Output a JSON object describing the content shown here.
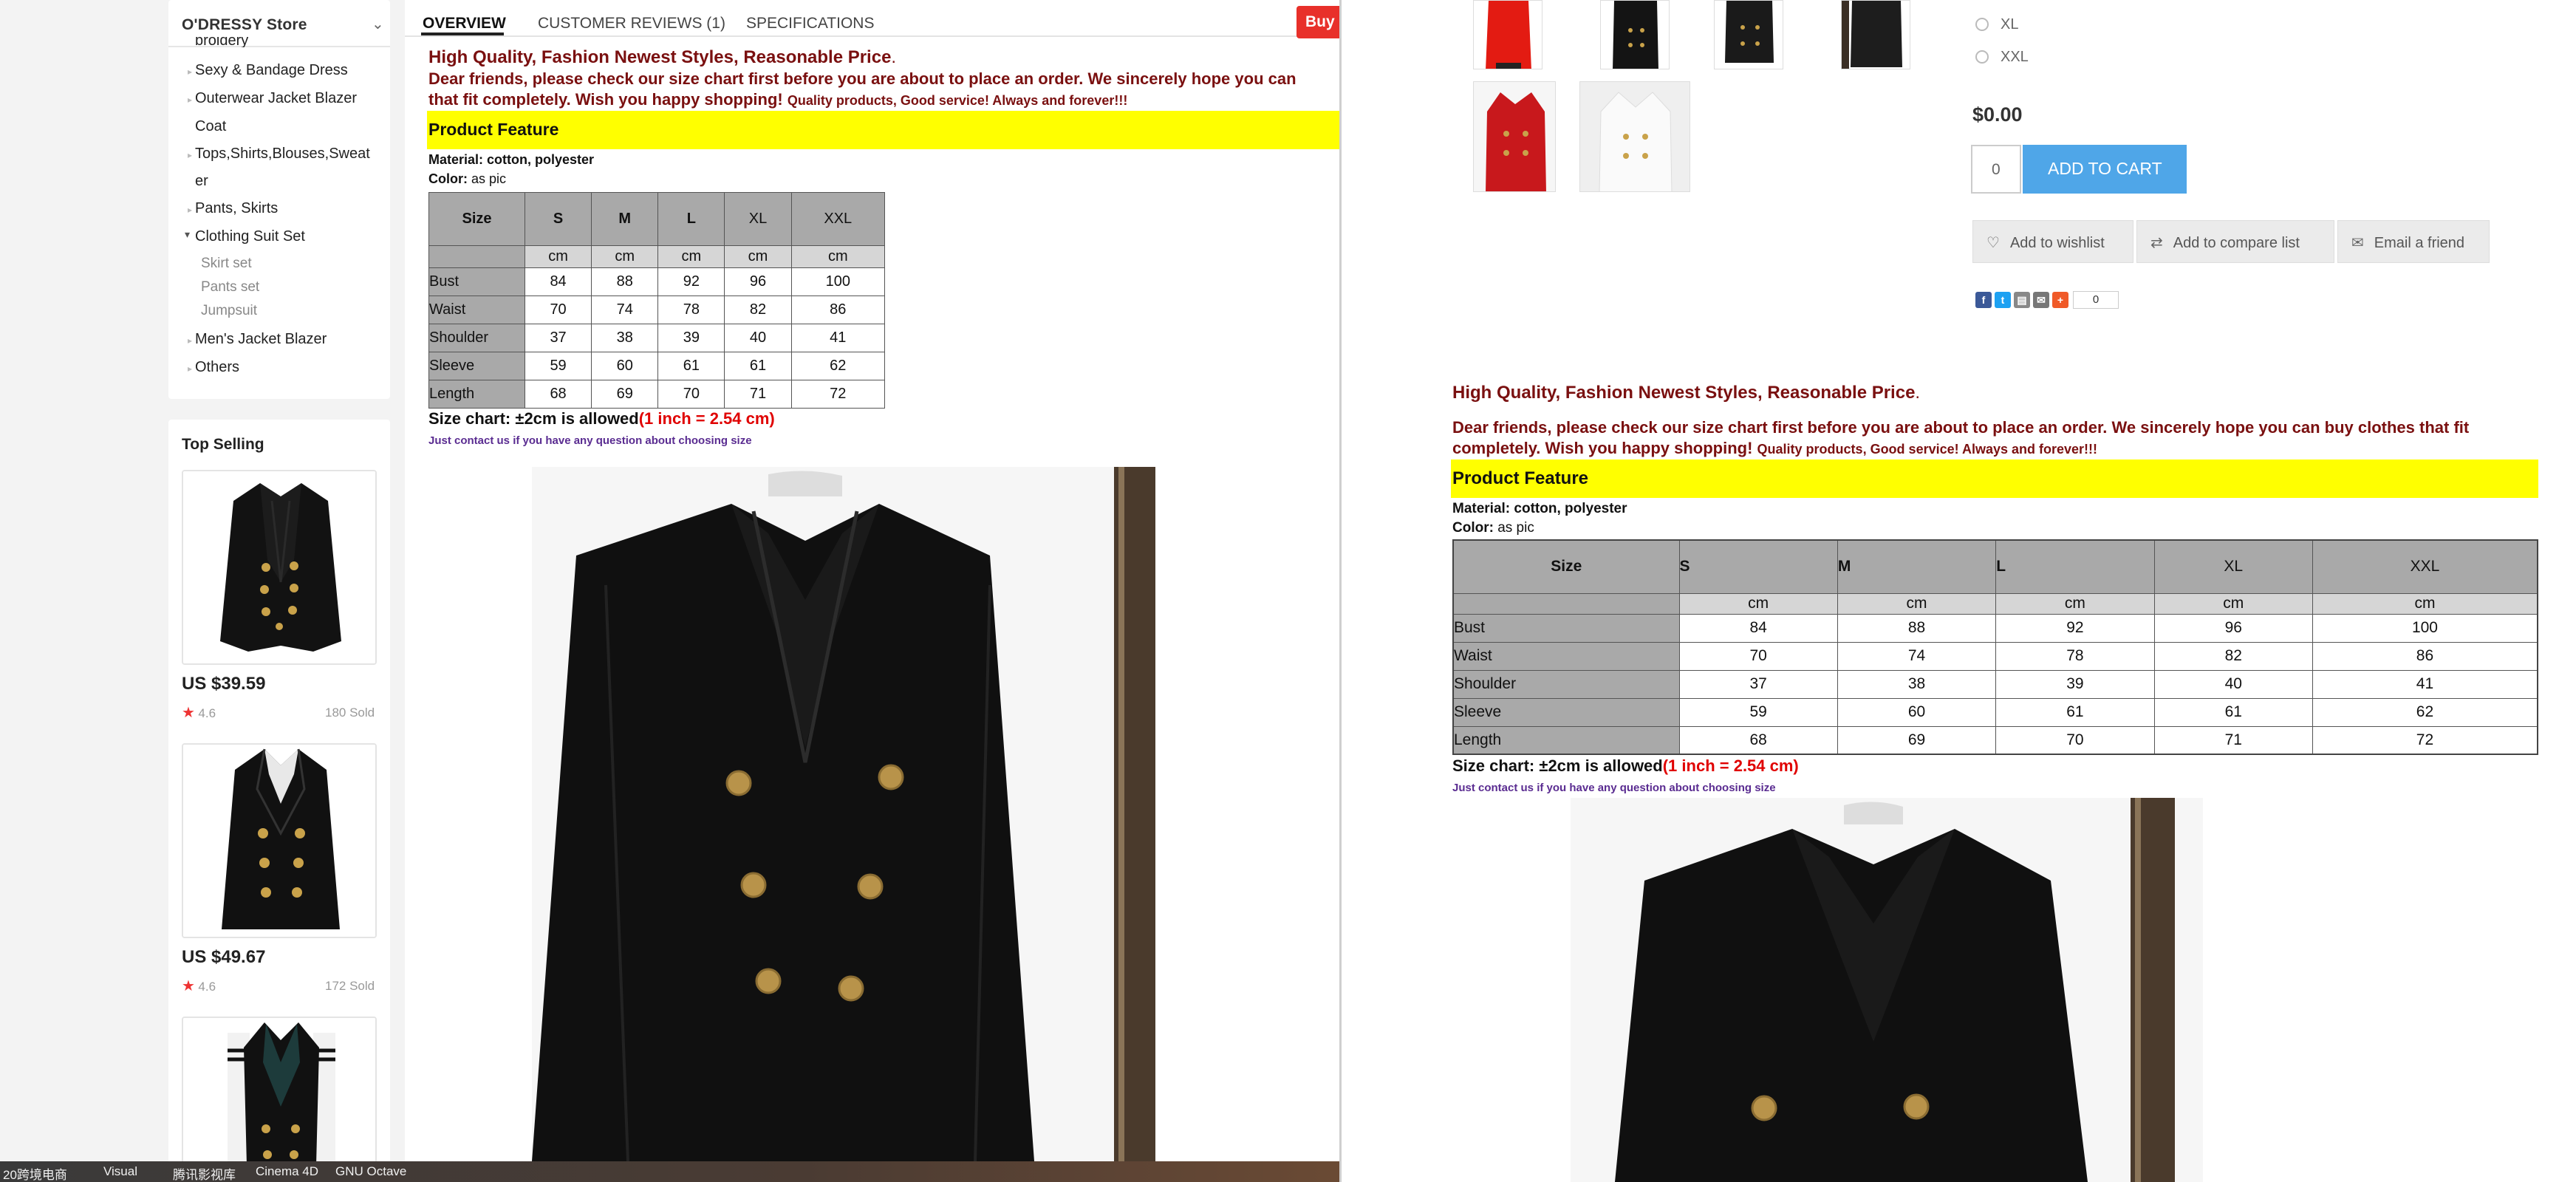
{
  "store": {
    "name": "O'DRESSY Store"
  },
  "sidebar": {
    "categories": [
      {
        "label": "broidery",
        "type": "cat"
      },
      {
        "label": "Sexy & Bandage Dress",
        "type": "cat"
      },
      {
        "label": "Outerwear Jacket Blazer",
        "type": "cat"
      },
      {
        "label": "Coat",
        "type": "cat"
      },
      {
        "label": "Tops,Shirts,Blouses,Sweat",
        "type": "cat"
      },
      {
        "label": "er",
        "type": "cat"
      },
      {
        "label": "Pants, Skirts",
        "type": "cat"
      },
      {
        "label": "Clothing Suit Set",
        "type": "cat"
      },
      {
        "label": "Skirt set",
        "type": "sub"
      },
      {
        "label": "Pants set",
        "type": "sub"
      },
      {
        "label": "Jumpsuit",
        "type": "sub"
      },
      {
        "label": "Men's Jacket Blazer",
        "type": "cat"
      },
      {
        "label": "Others",
        "type": "cat"
      }
    ]
  },
  "top_selling": {
    "title": "Top Selling",
    "items": [
      {
        "price": "US $39.59",
        "rating": "4.6",
        "sold": "180 Sold"
      },
      {
        "price": "US $49.67",
        "rating": "4.6",
        "sold": "172 Sold"
      }
    ]
  },
  "tabs": [
    "OVERVIEW",
    "CUSTOMER REVIEWS (1)",
    "SPECIFICATIONS"
  ],
  "buy_label": "Buy",
  "description": {
    "hq_text": "High Quality, Fashion Newest Styles, Reasonable Price",
    "hq_dot": ".",
    "dear_left_1": "Dear friends, please check our size chart first before you are about to place an order. We sincerely hope you can",
    "dear_left_2": "that fit completely. Wish you happy shopping!",
    "dear_right_1": "Dear friends, please check our size chart first before you are about to place an order. We sincerely hope you can buy clothes that fit",
    "dear_right_2": "completely. Wish you happy shopping!",
    "dear_small": "Quality products, Good service! Always and forever!!!",
    "product_feature": "Product Feature",
    "material_label": "Material:",
    "material_value": " cotton, polyester",
    "color_label": "Color:",
    "color_value": " as pic",
    "size_chart_text": "Size chart: ±2cm is allowed",
    "size_chart_note": "(1 inch = 2.54 cm)",
    "contact": "Just contact us if you have any question about choosing size"
  },
  "size_table": {
    "header": [
      "Size",
      "S",
      "M",
      "L",
      "XL",
      "XXL"
    ],
    "units": [
      "",
      "cm",
      "cm",
      "cm",
      "cm",
      "cm"
    ],
    "rows": [
      [
        "Bust",
        "84",
        "88",
        "92",
        "96",
        "100"
      ],
      [
        "Waist",
        "70",
        "74",
        "78",
        "82",
        "86"
      ],
      [
        "Shoulder",
        "37",
        "38",
        "39",
        "40",
        "41"
      ],
      [
        "Sleeve",
        "59",
        "60",
        "61",
        "61",
        "62"
      ],
      [
        "Length",
        "68",
        "69",
        "70",
        "71",
        "72"
      ]
    ]
  },
  "right_panel": {
    "sizes": [
      "XL",
      "XXL"
    ],
    "price": "$0.00",
    "qty": "0",
    "add_to_cart": "ADD TO CART",
    "wishlist": "Add to wishlist",
    "compare": "Add to compare list",
    "email": "Email a friend",
    "share_count": "0"
  },
  "taskbar": [
    "20跨境电商",
    "Visual",
    "腾讯影视库",
    "Cinema 4D",
    "GNU Octave"
  ]
}
